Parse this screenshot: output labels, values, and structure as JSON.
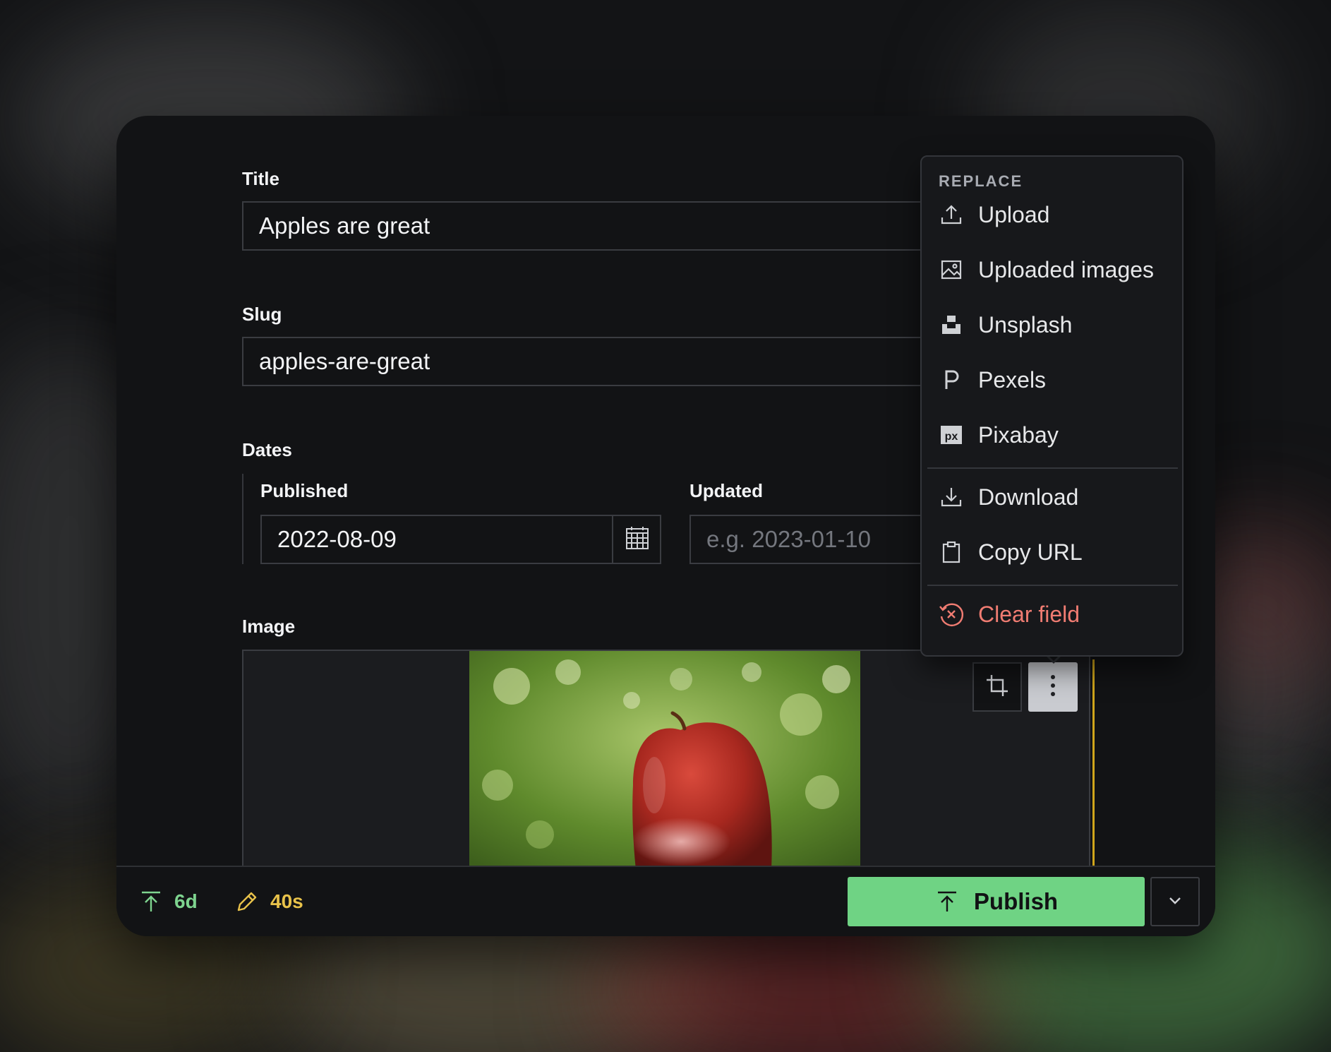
{
  "form": {
    "title_label": "Title",
    "title_value": "Apples are great",
    "slug_label": "Slug",
    "slug_value": "apples-are-great",
    "dates_label": "Dates",
    "published_label": "Published",
    "published_value": "2022-08-09",
    "updated_label": "Updated",
    "updated_placeholder": "e.g. 2023-01-10",
    "image_label": "Image"
  },
  "icons": {
    "calendar": "calendar-icon",
    "crop": "crop-icon",
    "more": "more-vertical-icon",
    "upload": "upload-icon",
    "gallery": "image-gallery-icon",
    "unsplash": "unsplash-icon",
    "pexels": "pexels-icon",
    "pixabay": "pixabay-icon",
    "download": "download-icon",
    "copy": "clipboard-icon",
    "clear": "clear-icon",
    "publish": "arrow-up-icon",
    "edit": "pencil-icon",
    "chevron": "chevron-down-icon"
  },
  "menu": {
    "heading": "REPLACE",
    "items": [
      {
        "label": "Upload"
      },
      {
        "label": "Uploaded images"
      },
      {
        "label": "Unsplash"
      },
      {
        "label": "Pexels"
      },
      {
        "label": "Pixabay"
      },
      {
        "label": "Download"
      },
      {
        "label": "Copy URL"
      },
      {
        "label": "Clear field"
      }
    ]
  },
  "footer": {
    "published_ago": "6d",
    "edited_ago": "40s",
    "publish_label": "Publish"
  },
  "colors": {
    "accent_green": "#6fd384",
    "published_text": "#7ed48f",
    "edited_text": "#e8c24a",
    "danger": "#f07c72",
    "field_accent": "#cfa51b"
  }
}
